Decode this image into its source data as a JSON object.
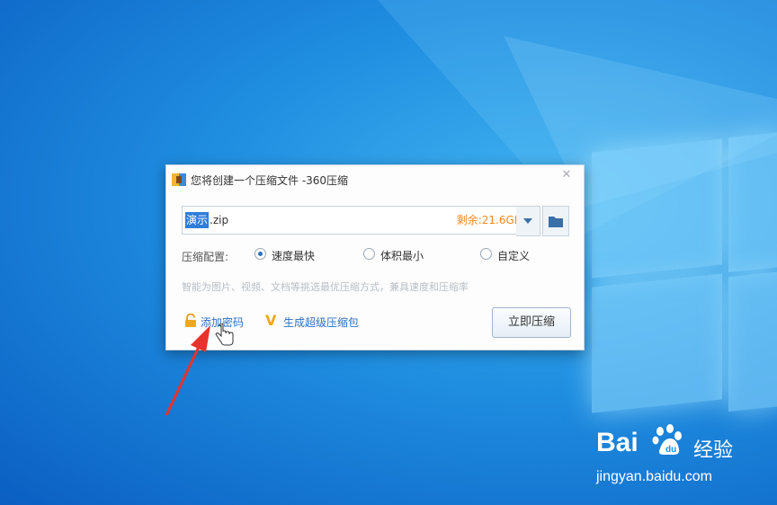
{
  "dialog": {
    "title": "您将创建一个压缩文件 -360压缩",
    "filename_selected": "演示",
    "filename_ext": ".zip",
    "free_space": "剩余:21.6GB",
    "config_label": "压缩配置:",
    "options": [
      {
        "label": "速度最快",
        "selected": true
      },
      {
        "label": "体积最小",
        "selected": false
      },
      {
        "label": "自定义",
        "selected": false
      }
    ],
    "hint": "智能为图片、视频、文档等挑选最优压缩方式，兼具速度和压缩率",
    "add_password": "添加密码",
    "super_pack": "生成超级压缩包",
    "compress_button": "立即压缩"
  },
  "watermark": {
    "brand": "Bai",
    "product": "经验",
    "url": "jingyan.baidu.com"
  },
  "colors": {
    "link": "#2c6fc2",
    "free_space": "#f08a24",
    "arrow": "#e8322c"
  }
}
